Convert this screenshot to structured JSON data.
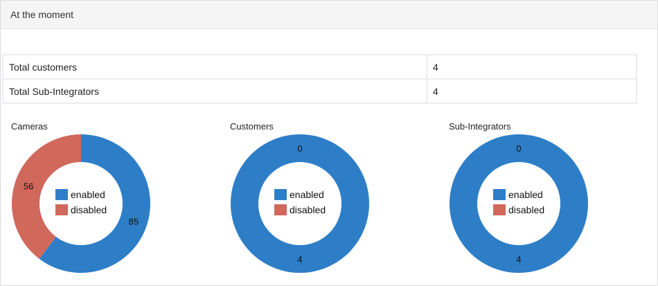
{
  "panel": {
    "title": "At the moment"
  },
  "stats": [
    {
      "label": "Total customers",
      "value": "4"
    },
    {
      "label": "Total Sub-Integrators",
      "value": "4"
    }
  ],
  "colors": {
    "enabled": "#2e7ec7",
    "disabled": "#d0685c"
  },
  "legend": {
    "enabled": "enabled",
    "disabled": "disabled"
  },
  "chart_data": [
    {
      "type": "pie",
      "title": "Cameras",
      "categories": [
        "enabled",
        "disabled"
      ],
      "values": [
        85,
        56
      ],
      "labels": [
        "85",
        "56"
      ]
    },
    {
      "type": "pie",
      "title": "Customers",
      "categories": [
        "enabled",
        "disabled"
      ],
      "values": [
        4,
        0
      ],
      "labels": [
        "4",
        "0"
      ]
    },
    {
      "type": "pie",
      "title": "Sub-Integrators",
      "categories": [
        "enabled",
        "disabled"
      ],
      "values": [
        4,
        0
      ],
      "labels": [
        "4",
        "0"
      ]
    }
  ]
}
